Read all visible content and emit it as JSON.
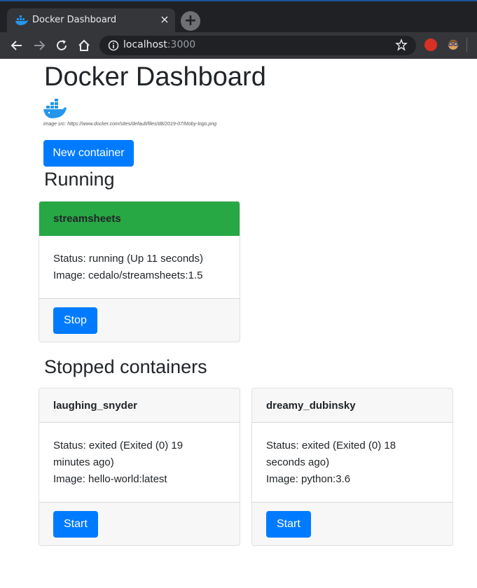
{
  "browser": {
    "tab_title": "Docker Dashboard",
    "tab_close": "×",
    "new_tab": "+",
    "url_host": "localhost",
    "url_port": ":3000"
  },
  "page": {
    "title": "Docker Dashboard",
    "image_src_caption": "image src: https://www.docker.com/sites/default/files/d8/2019-07/Moby-logo.png",
    "new_container_label": "New container",
    "running_heading": "Running",
    "stopped_heading": "Stopped containers"
  },
  "running": [
    {
      "name": "streamsheets",
      "status": "Status: running (Up 11 seconds)",
      "image": "Image: cedalo/streamsheets:1.5",
      "action": "Stop"
    }
  ],
  "stopped": [
    {
      "name": "laughing_snyder",
      "status_line1": "Status: exited (Exited (0) 19",
      "status_line2": "minutes ago)",
      "image": "Image: hello-world:latest",
      "action": "Start"
    },
    {
      "name": "dreamy_dubinsky",
      "status_line1": "Status: exited (Exited (0) 18",
      "status_line2": "seconds ago)",
      "image": "Image: python:3.6",
      "action": "Start"
    }
  ],
  "colors": {
    "primary": "#007bff",
    "running_header": "#28a745",
    "chrome_bg": "#202124"
  }
}
